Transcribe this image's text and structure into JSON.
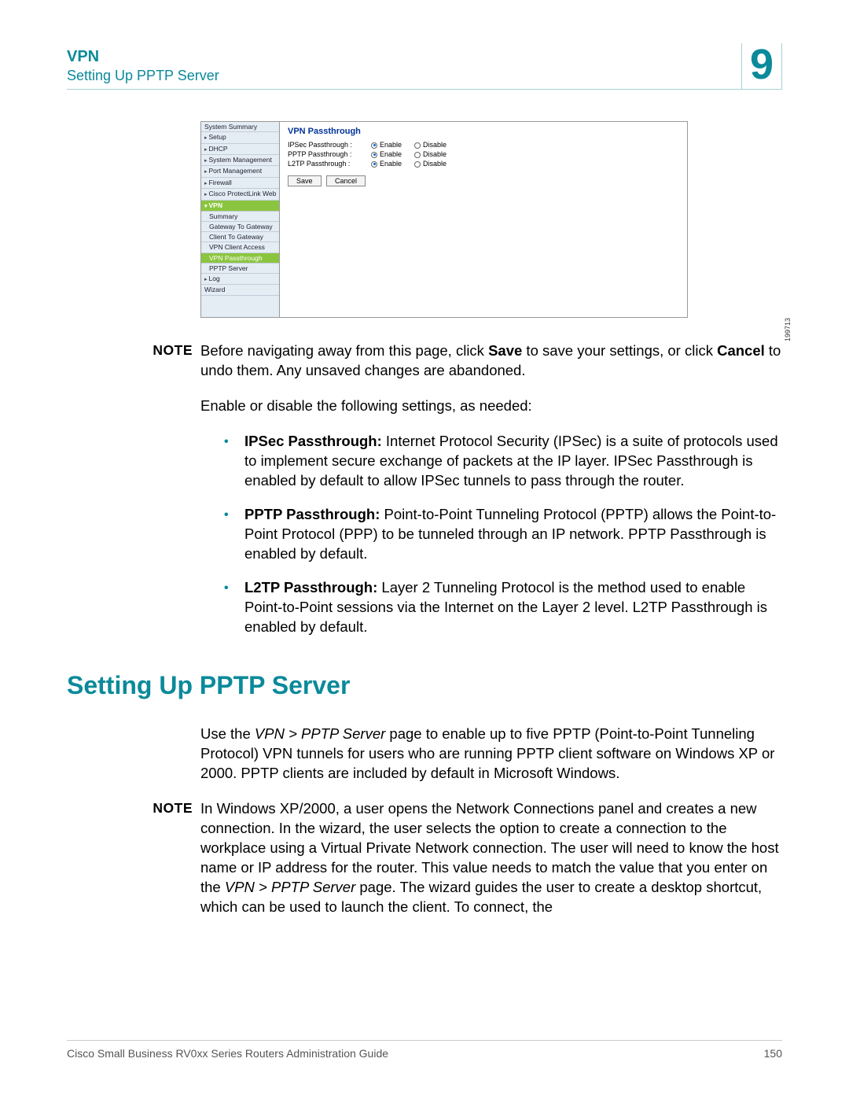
{
  "header": {
    "chapter": "VPN",
    "subtitle": "Setting Up PPTP Server",
    "number": "9"
  },
  "screenshot": {
    "image_id": "199713",
    "nav": {
      "items": [
        {
          "label": "System Summary",
          "type": "item"
        },
        {
          "label": "Setup",
          "type": "exp"
        },
        {
          "label": "DHCP",
          "type": "exp"
        },
        {
          "label": "System Management",
          "type": "exp"
        },
        {
          "label": "Port Management",
          "type": "exp"
        },
        {
          "label": "Firewall",
          "type": "exp"
        },
        {
          "label": "Cisco ProtectLink Web",
          "type": "exp"
        },
        {
          "label": "VPN",
          "type": "active"
        },
        {
          "label": "Summary",
          "type": "sub"
        },
        {
          "label": "Gateway To Gateway",
          "type": "sub"
        },
        {
          "label": "Client To Gateway",
          "type": "sub"
        },
        {
          "label": "VPN Client Access",
          "type": "sub"
        },
        {
          "label": "VPN Passthrough",
          "type": "sub-hl"
        },
        {
          "label": "PPTP Server",
          "type": "sub"
        },
        {
          "label": "Log",
          "type": "exp"
        },
        {
          "label": "Wizard",
          "type": "item"
        }
      ]
    },
    "panel": {
      "title": "VPN Passthrough",
      "rows": [
        {
          "label": "IPSec Passthrough :",
          "enable": "Enable",
          "disable": "Disable"
        },
        {
          "label": "PPTP Passthrough :",
          "enable": "Enable",
          "disable": "Disable"
        },
        {
          "label": "L2TP Passthrough :",
          "enable": "Enable",
          "disable": "Disable"
        }
      ],
      "save": "Save",
      "cancel": "Cancel"
    }
  },
  "note1": {
    "label": "NOTE",
    "p1": "Before navigating away from this page, click ",
    "b1": "Save",
    "p2": " to save your settings, or click ",
    "b2": "Cancel",
    "p3": " to undo them. Any unsaved changes are abandoned."
  },
  "para1": "Enable or disable the following settings, as needed:",
  "bullets": [
    {
      "bold": "IPSec Passthrough: ",
      "text": "Internet Protocol Security (IPSec) is a suite of protocols used to implement secure exchange of packets at the IP layer. IPSec Passthrough is enabled by default to allow IPSec tunnels to pass through the router."
    },
    {
      "bold": "PPTP Passthrough: ",
      "text": "Point-to-Point Tunneling Protocol (PPTP) allows the Point-to-Point Protocol (PPP) to be tunneled through an IP network. PPTP Passthrough is enabled by default."
    },
    {
      "bold": "L2TP Passthrough: ",
      "text": "Layer 2 Tunneling Protocol is the method used to enable Point-to-Point sessions via the Internet on the Layer 2 level. L2TP Passthrough is enabled by default."
    }
  ],
  "heading2": "Setting Up PPTP Server",
  "para2": {
    "p1": "Use the ",
    "i1": "VPN > PPTP Server",
    "p2": " page to enable up to five PPTP (Point-to-Point Tunneling Protocol) VPN tunnels for users who are running PPTP client software on Windows XP or 2000. PPTP clients are included by default in Microsoft Windows."
  },
  "note2": {
    "label": "NOTE",
    "p1": "In Windows XP/2000, a user opens the Network Connections panel and creates a new connection. In the wizard, the user selects the option to create a connection to the workplace using a Virtual Private Network connection. The user will need to know the host name or IP address for the router. This value needs to match the value that you enter on the ",
    "i1": "VPN > PPTP Server",
    "p2": " page. The wizard guides the user to create a desktop shortcut, which can be used to launch the client. To connect, the"
  },
  "footer": {
    "left": "Cisco Small Business RV0xx Series Routers Administration Guide",
    "right": "150"
  }
}
